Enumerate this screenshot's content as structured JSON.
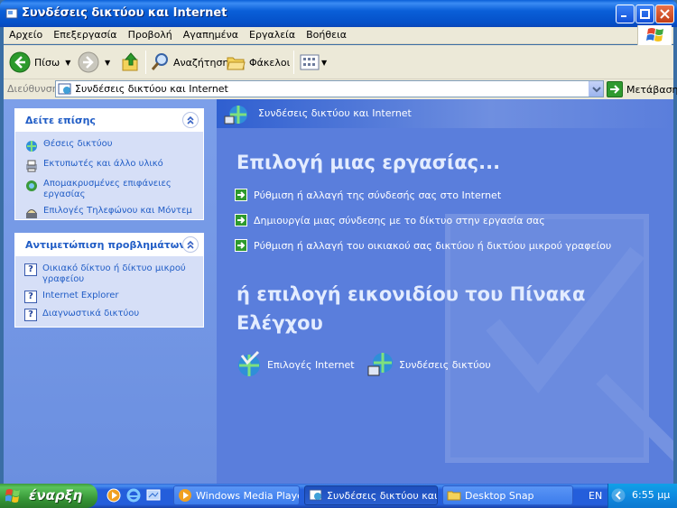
{
  "window": {
    "title": "Συνδέσεις δικτύου και Internet",
    "controls": [
      "minimize-icon",
      "maximize-icon",
      "close-icon"
    ]
  },
  "menu": {
    "items": [
      "Αρχείο",
      "Επεξεργασία",
      "Προβολή",
      "Αγαπημένα",
      "Εργαλεία",
      "Βοήθεια"
    ]
  },
  "toolbar": {
    "back_label": "Πίσω",
    "search_label": "Αναζήτηση",
    "folders_label": "Φάκελοι"
  },
  "address": {
    "label": "Διεύθυνση",
    "value": "Συνδέσεις δικτύου και Internet",
    "go_label": "Μετάβαση"
  },
  "sidebar": {
    "see_also": {
      "title": "Δείτε επίσης",
      "items": [
        {
          "label": "Θέσεις δικτύου",
          "icon": "network-places-icon"
        },
        {
          "label": "Εκτυπωτές και άλλο υλικό",
          "icon": "printer-icon"
        },
        {
          "label": "Απομακρυσμένες επιφάνειες εργασίας",
          "icon": "remote-desktop-icon"
        },
        {
          "label": "Επιλογές Τηλεφώνου και Μόντεμ",
          "icon": "phone-modem-icon"
        }
      ]
    },
    "troubleshooting": {
      "title": "Αντιμετώπιση προβλημάτων",
      "items": [
        {
          "label": "Οικιακό δίκτυο ή δίκτυο μικρού γραφείου",
          "icon": "help-icon"
        },
        {
          "label": "Internet Explorer",
          "icon": "help-icon"
        },
        {
          "label": "Διαγνωστικά δικτύου",
          "icon": "help-icon"
        }
      ]
    }
  },
  "main": {
    "header": "Συνδέσεις δικτύου και Internet",
    "pick_task": "Επιλογή μιας εργασίας...",
    "tasks": [
      "Ρύθμιση ή αλλαγή της σύνδεσής σας στο Internet",
      "Δημιουργία μιας σύνδεσης με το δίκτυο στην εργασία σας",
      "Ρύθμιση ή αλλαγή του οικιακού σας δικτύου ή δικτύου μικρού γραφείου"
    ],
    "pick_icon_line1": "ή επιλογή εικονιδίου του Πίνακα",
    "pick_icon_line2": "Ελέγχου",
    "icons": [
      {
        "label": "Επιλογές Internet",
        "icon": "internet-options-icon"
      },
      {
        "label": "Συνδέσεις δικτύου",
        "icon": "network-connections-icon"
      }
    ]
  },
  "taskbar": {
    "start_label": "έναρξη",
    "buttons": [
      {
        "label": "Windows Media Player",
        "active": false
      },
      {
        "label": "Συνδέσεις δικτύου και...",
        "active": true
      },
      {
        "label": "Desktop Snap",
        "active": false
      }
    ],
    "language": "EN",
    "clock": "6:55 μμ"
  }
}
